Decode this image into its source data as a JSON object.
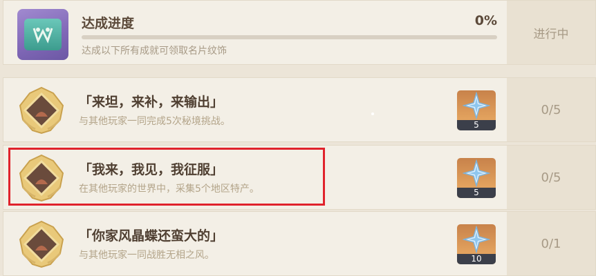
{
  "progress": {
    "title": "达成进度",
    "percent_text": "0%",
    "percent_value": 0,
    "description": "达成以下所有成就可领取名片纹饰",
    "status": "进行中",
    "icon": "namecard-icon"
  },
  "achievements": [
    {
      "title": "「来坦，来补，来输出」",
      "description": "与其他玩家一同完成5次秘境挑战。",
      "reward_icon": "primogem-icon",
      "reward_count": "5",
      "progress": "0/5",
      "highlighted": false
    },
    {
      "title": "「我来，我见，我征服」",
      "description": "在其他玩家的世界中，采集5个地区特产。",
      "reward_icon": "primogem-icon",
      "reward_count": "5",
      "progress": "0/5",
      "highlighted": true
    },
    {
      "title": "「你家风晶蝶还蛮大的」",
      "description": "与其他玩家一同战胜无相之风。",
      "reward_icon": "primogem-icon",
      "reward_count": "10",
      "progress": "0/1",
      "highlighted": false
    }
  ],
  "colors": {
    "highlight": "#e0222b",
    "reward_bg": "#e2a25e",
    "title": "#4f3f31"
  }
}
